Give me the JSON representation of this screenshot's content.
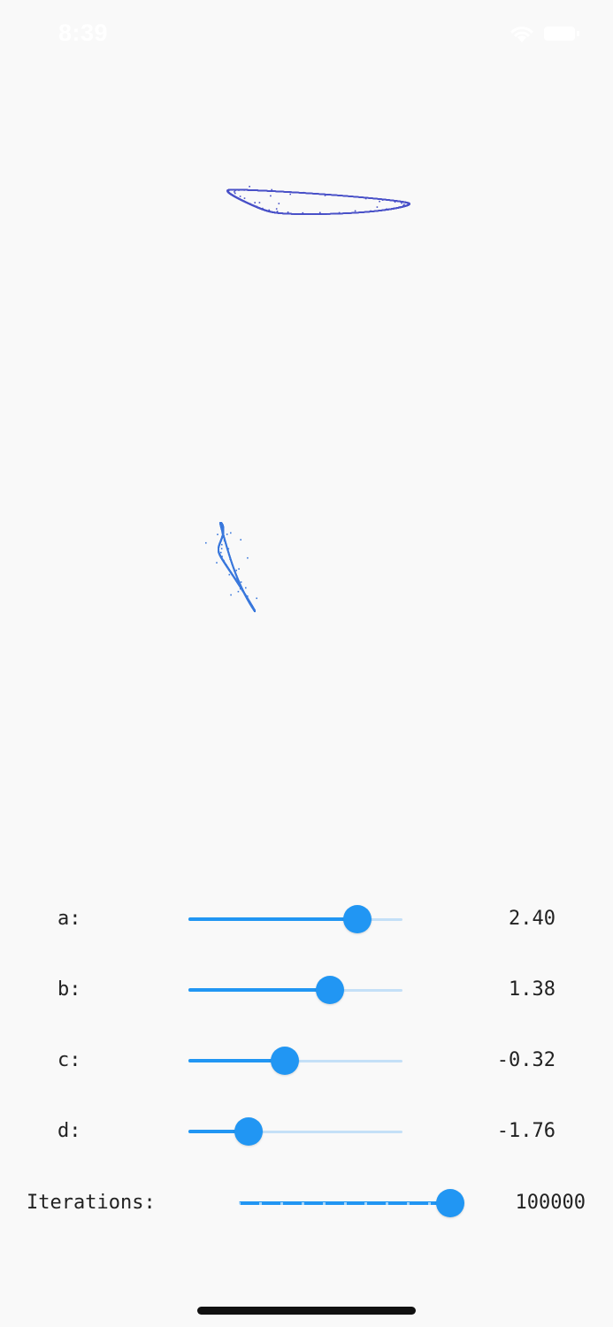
{
  "status_bar": {
    "time": "8:39",
    "icons": [
      "wifi-icon",
      "battery-icon"
    ]
  },
  "attractor": {
    "description_colors": {
      "top": "#4a52c8",
      "bottom": "#3a78dc"
    }
  },
  "controls": [
    {
      "id": "a",
      "label": "a:",
      "value_text": "2.40",
      "fraction": 0.79
    },
    {
      "id": "b",
      "label": "b:",
      "value_text": "1.38",
      "fraction": 0.66
    },
    {
      "id": "c",
      "label": "c:",
      "value_text": "-0.32",
      "fraction": 0.45
    },
    {
      "id": "d",
      "label": "d:",
      "value_text": "-1.76",
      "fraction": 0.28
    }
  ],
  "iterations": {
    "label": "Iterations:",
    "value_text": "100000",
    "fraction": 1.0,
    "divisions": 10
  },
  "colors": {
    "accent": "#2196f3",
    "track_inactive": "#c4e0f7",
    "background": "#f9f9f9"
  }
}
